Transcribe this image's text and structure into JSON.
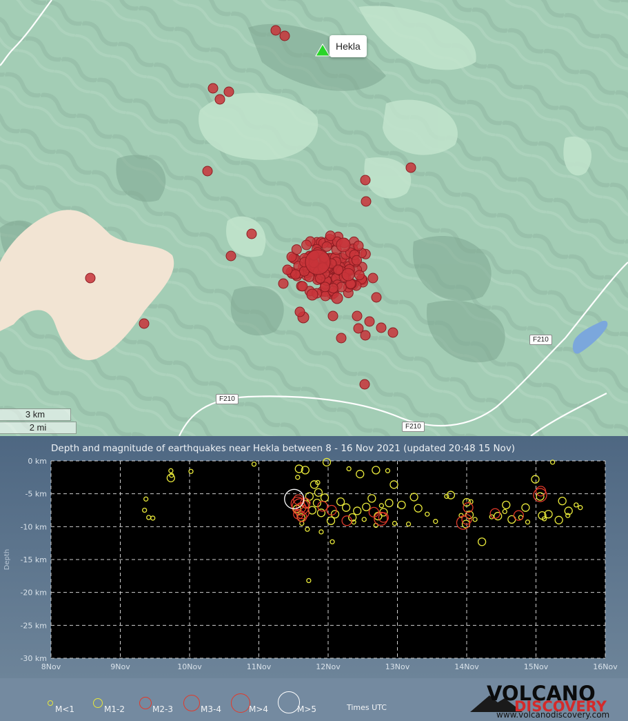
{
  "map": {
    "volcano_name": "Hekla",
    "scale_km": "3 km",
    "scale_mi": "2 mi",
    "roads": [
      "F210",
      "F210",
      "F210"
    ],
    "colors": {
      "land": "#a3cdb5",
      "highlight": "#c1e3cc",
      "sand": "#f2e4d3",
      "lake": "#7ba7dc",
      "quake_fill": "#c8343a",
      "volcano": "#2ad52a"
    },
    "icons": [
      "volcano-triangle-icon"
    ]
  },
  "chart_data": {
    "type": "scatter",
    "title": "Depth and magnitude of earthquakes near Hekla between 8 - 16 Nov 2021 (updated 20:48 15 Nov)",
    "ylabel": "Depth",
    "xlabel": "",
    "x_ticks": [
      "8Nov",
      "9Nov",
      "10Nov",
      "11Nov",
      "12Nov",
      "13Nov",
      "14Nov",
      "15Nov",
      "16Nov"
    ],
    "y_ticks": [
      "0 km",
      "-5 km",
      "-10 km",
      "-15 km",
      "-20 km",
      "-25 km",
      "-30 km"
    ],
    "xlim_days": [
      8,
      16
    ],
    "ylim_km": [
      -30,
      0
    ],
    "grid": true,
    "background": "#000000",
    "series": [
      {
        "name": "M<1",
        "color": "#e8e83a",
        "points": [
          [
            9.73,
            -1.5
          ],
          [
            9.74,
            -2.2
          ],
          [
            10.02,
            -1.6
          ],
          [
            10.93,
            -0.5
          ],
          [
            9.37,
            -5.8
          ],
          [
            9.41,
            -8.6
          ],
          [
            9.47,
            -8.7
          ],
          [
            9.35,
            -7.5
          ],
          [
            11.62,
            -9.5
          ],
          [
            11.7,
            -10.4
          ],
          [
            11.9,
            -10.8
          ],
          [
            12.06,
            -12.3
          ],
          [
            12.37,
            -9.3
          ],
          [
            12.52,
            -8.9
          ],
          [
            12.69,
            -9.8
          ],
          [
            12.96,
            -9.5
          ],
          [
            13.16,
            -9.6
          ],
          [
            13.55,
            -9.2
          ],
          [
            13.71,
            -5.4
          ],
          [
            13.92,
            -8.3
          ],
          [
            14.06,
            -6.2
          ],
          [
            14.12,
            -8.9
          ],
          [
            14.36,
            -8.5
          ],
          [
            14.55,
            -7.7
          ],
          [
            14.78,
            -8.6
          ],
          [
            14.88,
            -9.3
          ],
          [
            15.12,
            -8.8
          ],
          [
            15.24,
            -0.2
          ],
          [
            15.46,
            -8.3
          ],
          [
            15.58,
            -6.7
          ],
          [
            15.64,
            -7.1
          ],
          [
            11.72,
            -18.2
          ],
          [
            12.86,
            -1.5
          ],
          [
            12.3,
            -1.2
          ],
          [
            11.56,
            -2.5
          ],
          [
            11.85,
            -3.3
          ],
          [
            12.77,
            -6.8
          ],
          [
            13.43,
            -8.1
          ]
        ]
      },
      {
        "name": "M1-2",
        "color": "#e8e83a",
        "points": [
          [
            9.73,
            -2.6
          ],
          [
            11.58,
            -1.2
          ],
          [
            11.67,
            -1.4
          ],
          [
            11.8,
            -3.6
          ],
          [
            11.86,
            -4.8
          ],
          [
            11.98,
            -0.2
          ],
          [
            12.46,
            -2.0
          ],
          [
            12.69,
            -1.4
          ],
          [
            12.95,
            -3.6
          ],
          [
            12.63,
            -5.7
          ],
          [
            12.26,
            -7.1
          ],
          [
            12.1,
            -8.1
          ],
          [
            12.42,
            -7.6
          ],
          [
            13.24,
            -5.5
          ],
          [
            13.06,
            -6.7
          ],
          [
            12.8,
            -7.8
          ],
          [
            13.77,
            -5.2
          ],
          [
            14.0,
            -6.3
          ],
          [
            14.22,
            -12.3
          ],
          [
            14.04,
            -8.2
          ],
          [
            14.57,
            -6.7
          ],
          [
            14.85,
            -7.1
          ],
          [
            14.99,
            -2.8
          ],
          [
            15.06,
            -5.4
          ],
          [
            15.47,
            -7.6
          ],
          [
            15.33,
            -9.0
          ],
          [
            15.18,
            -8.1
          ],
          [
            13.99,
            -9.6
          ],
          [
            12.04,
            -9.1
          ],
          [
            11.55,
            -7.3
          ],
          [
            11.68,
            -6.6
          ],
          [
            11.77,
            -7.5
          ],
          [
            11.84,
            -6.4
          ],
          [
            11.9,
            -7.9
          ],
          [
            11.61,
            -8.6
          ],
          [
            12.18,
            -6.2
          ],
          [
            12.55,
            -7.0
          ],
          [
            12.35,
            -8.6
          ],
          [
            12.72,
            -8.4
          ],
          [
            13.3,
            -7.2
          ],
          [
            14.45,
            -8.4
          ],
          [
            14.65,
            -8.9
          ],
          [
            15.09,
            -8.3
          ],
          [
            15.38,
            -6.1
          ],
          [
            11.73,
            -5.4
          ],
          [
            11.95,
            -5.6
          ],
          [
            12.88,
            -6.4
          ]
        ]
      },
      {
        "name": "M2-3",
        "color": "#e23a2a",
        "points": [
          [
            11.57,
            -5.9
          ],
          [
            11.61,
            -7.1
          ],
          [
            11.57,
            -8.1
          ],
          [
            11.62,
            -8.5
          ],
          [
            11.92,
            -6.9
          ],
          [
            12.05,
            -7.5
          ],
          [
            12.27,
            -9.1
          ],
          [
            12.66,
            -7.8
          ],
          [
            12.8,
            -8.6
          ],
          [
            14.02,
            -7.1
          ],
          [
            14.0,
            -8.9
          ],
          [
            14.41,
            -8.0
          ],
          [
            14.75,
            -8.3
          ],
          [
            15.07,
            -4.6
          ],
          [
            11.67,
            -6.4
          ]
        ]
      },
      {
        "name": "M3-4",
        "color": "#e23a2a",
        "points": [
          [
            11.56,
            -6.5
          ],
          [
            11.63,
            -7.8
          ],
          [
            12.76,
            -8.8
          ],
          [
            13.95,
            -9.4
          ],
          [
            15.06,
            -5.2
          ]
        ]
      },
      {
        "name": "M>4",
        "color": "#e23a2a",
        "points": [
          [
            11.6,
            -7.0
          ]
        ]
      },
      {
        "name": "M>5",
        "color": "#ffffff",
        "points": [
          [
            11.51,
            -5.8
          ]
        ]
      }
    ]
  },
  "legend": {
    "items": [
      "M<1",
      "M1-2",
      "M2-3",
      "M3-4",
      "M>4",
      "M>5"
    ],
    "note": "Times UTC"
  },
  "logo": {
    "main": "VOLCANO",
    "sub": "DISCOVERY",
    "url": "www.volcanodiscovery.com"
  }
}
